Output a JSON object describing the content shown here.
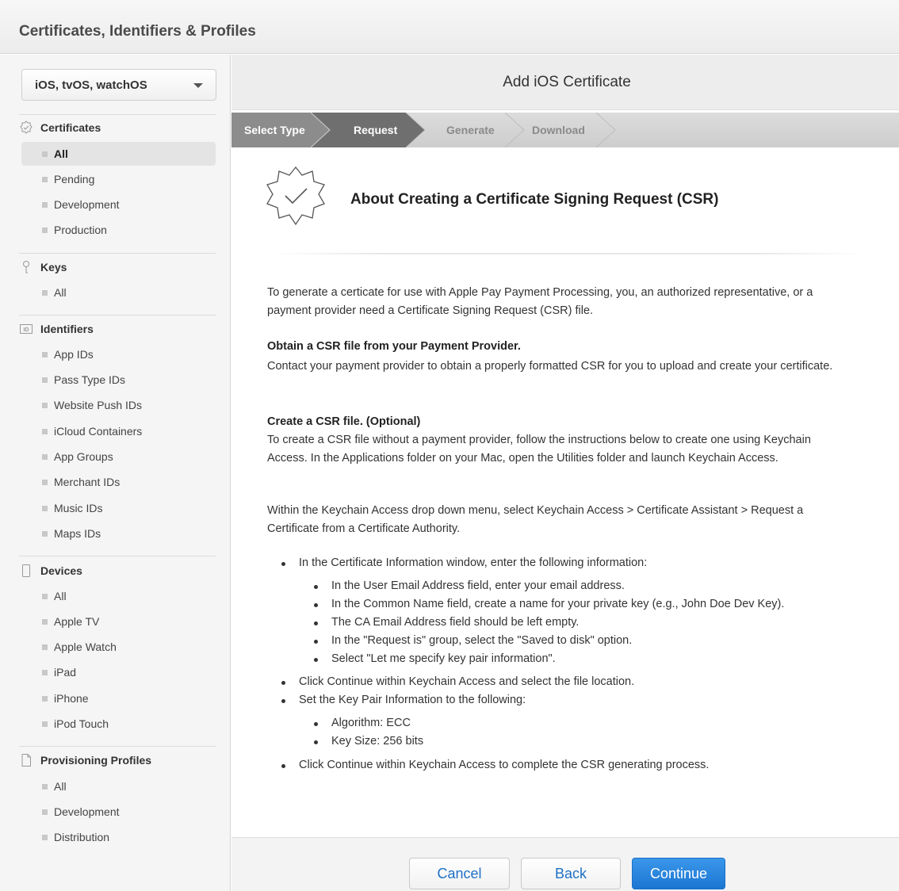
{
  "app": {
    "title": "Certificates, Identifiers & Profiles"
  },
  "sidebar": {
    "platform": "iOS, tvOS, watchOS",
    "sections": [
      {
        "title": "Certificates",
        "icon": "certificate-icon",
        "items": [
          "All",
          "Pending",
          "Development",
          "Production"
        ],
        "active_index": 0
      },
      {
        "title": "Keys",
        "icon": "key-icon",
        "items": [
          "All"
        ]
      },
      {
        "title": "Identifiers",
        "icon": "id-icon",
        "items": [
          "App IDs",
          "Pass Type IDs",
          "Website Push IDs",
          "iCloud Containers",
          "App Groups",
          "Merchant IDs",
          "Music IDs",
          "Maps IDs"
        ]
      },
      {
        "title": "Devices",
        "icon": "device-icon",
        "items": [
          "All",
          "Apple TV",
          "Apple Watch",
          "iPad",
          "iPhone",
          "iPod Touch"
        ]
      },
      {
        "title": "Provisioning Profiles",
        "icon": "document-icon",
        "items": [
          "All",
          "Development",
          "Distribution"
        ]
      }
    ]
  },
  "main": {
    "title": "Add iOS Certificate",
    "steps": [
      {
        "label": "Select Type",
        "state": "done"
      },
      {
        "label": "Request",
        "state": "current"
      },
      {
        "label": "Generate",
        "state": "upcoming"
      },
      {
        "label": "Download",
        "state": "upcoming"
      }
    ],
    "content_title": "About Creating a Certificate Signing Request (CSR)",
    "intro": "To generate a certicate for use with Apple Pay Payment Processing, you, an authorized representative, or a payment provider need a Certificate Signing Request (CSR) file.",
    "obtain_heading": "Obtain a CSR file from your Payment Provider.",
    "obtain_text": "Contact your payment provider to obtain a properly formatted CSR for you to upload and create your certificate.",
    "create_heading": "Create a CSR file. (Optional)",
    "create_text": "To create a CSR file without a payment provider, follow the instructions below to create one using Keychain Access. In the Applications folder on your Mac, open the Utilities folder and launch Keychain Access.",
    "within_text": "Within the Keychain Access drop down menu, select Keychain Access > Certificate Assistant > Request a Certificate from a Certificate Authority.",
    "bullets": {
      "b1": "In the Certificate Information window, enter the following information:",
      "b1_sub": [
        "In the User Email Address field, enter your email address.",
        "In the Common Name field, create a name for your private key (e.g., John Doe Dev Key).",
        "The CA Email Address field should be left empty.",
        "In the \"Request is\" group, select the \"Saved to disk\" option.",
        "Select \"Let me specify key pair information\"."
      ],
      "b2": "Click Continue within Keychain Access and select the file location.",
      "b3": "Set the Key Pair Information to the following:",
      "b3_sub": [
        "Algorithm: ECC",
        "Key Size: 256 bits"
      ],
      "b4": "Click Continue within Keychain Access to complete the CSR generating process."
    },
    "buttons": {
      "cancel": "Cancel",
      "back": "Back",
      "continue": "Continue"
    }
  },
  "colors": {
    "accent": "#1b76d3",
    "step_active": "#8c8c8c",
    "step_current": "#6f6f6f"
  }
}
